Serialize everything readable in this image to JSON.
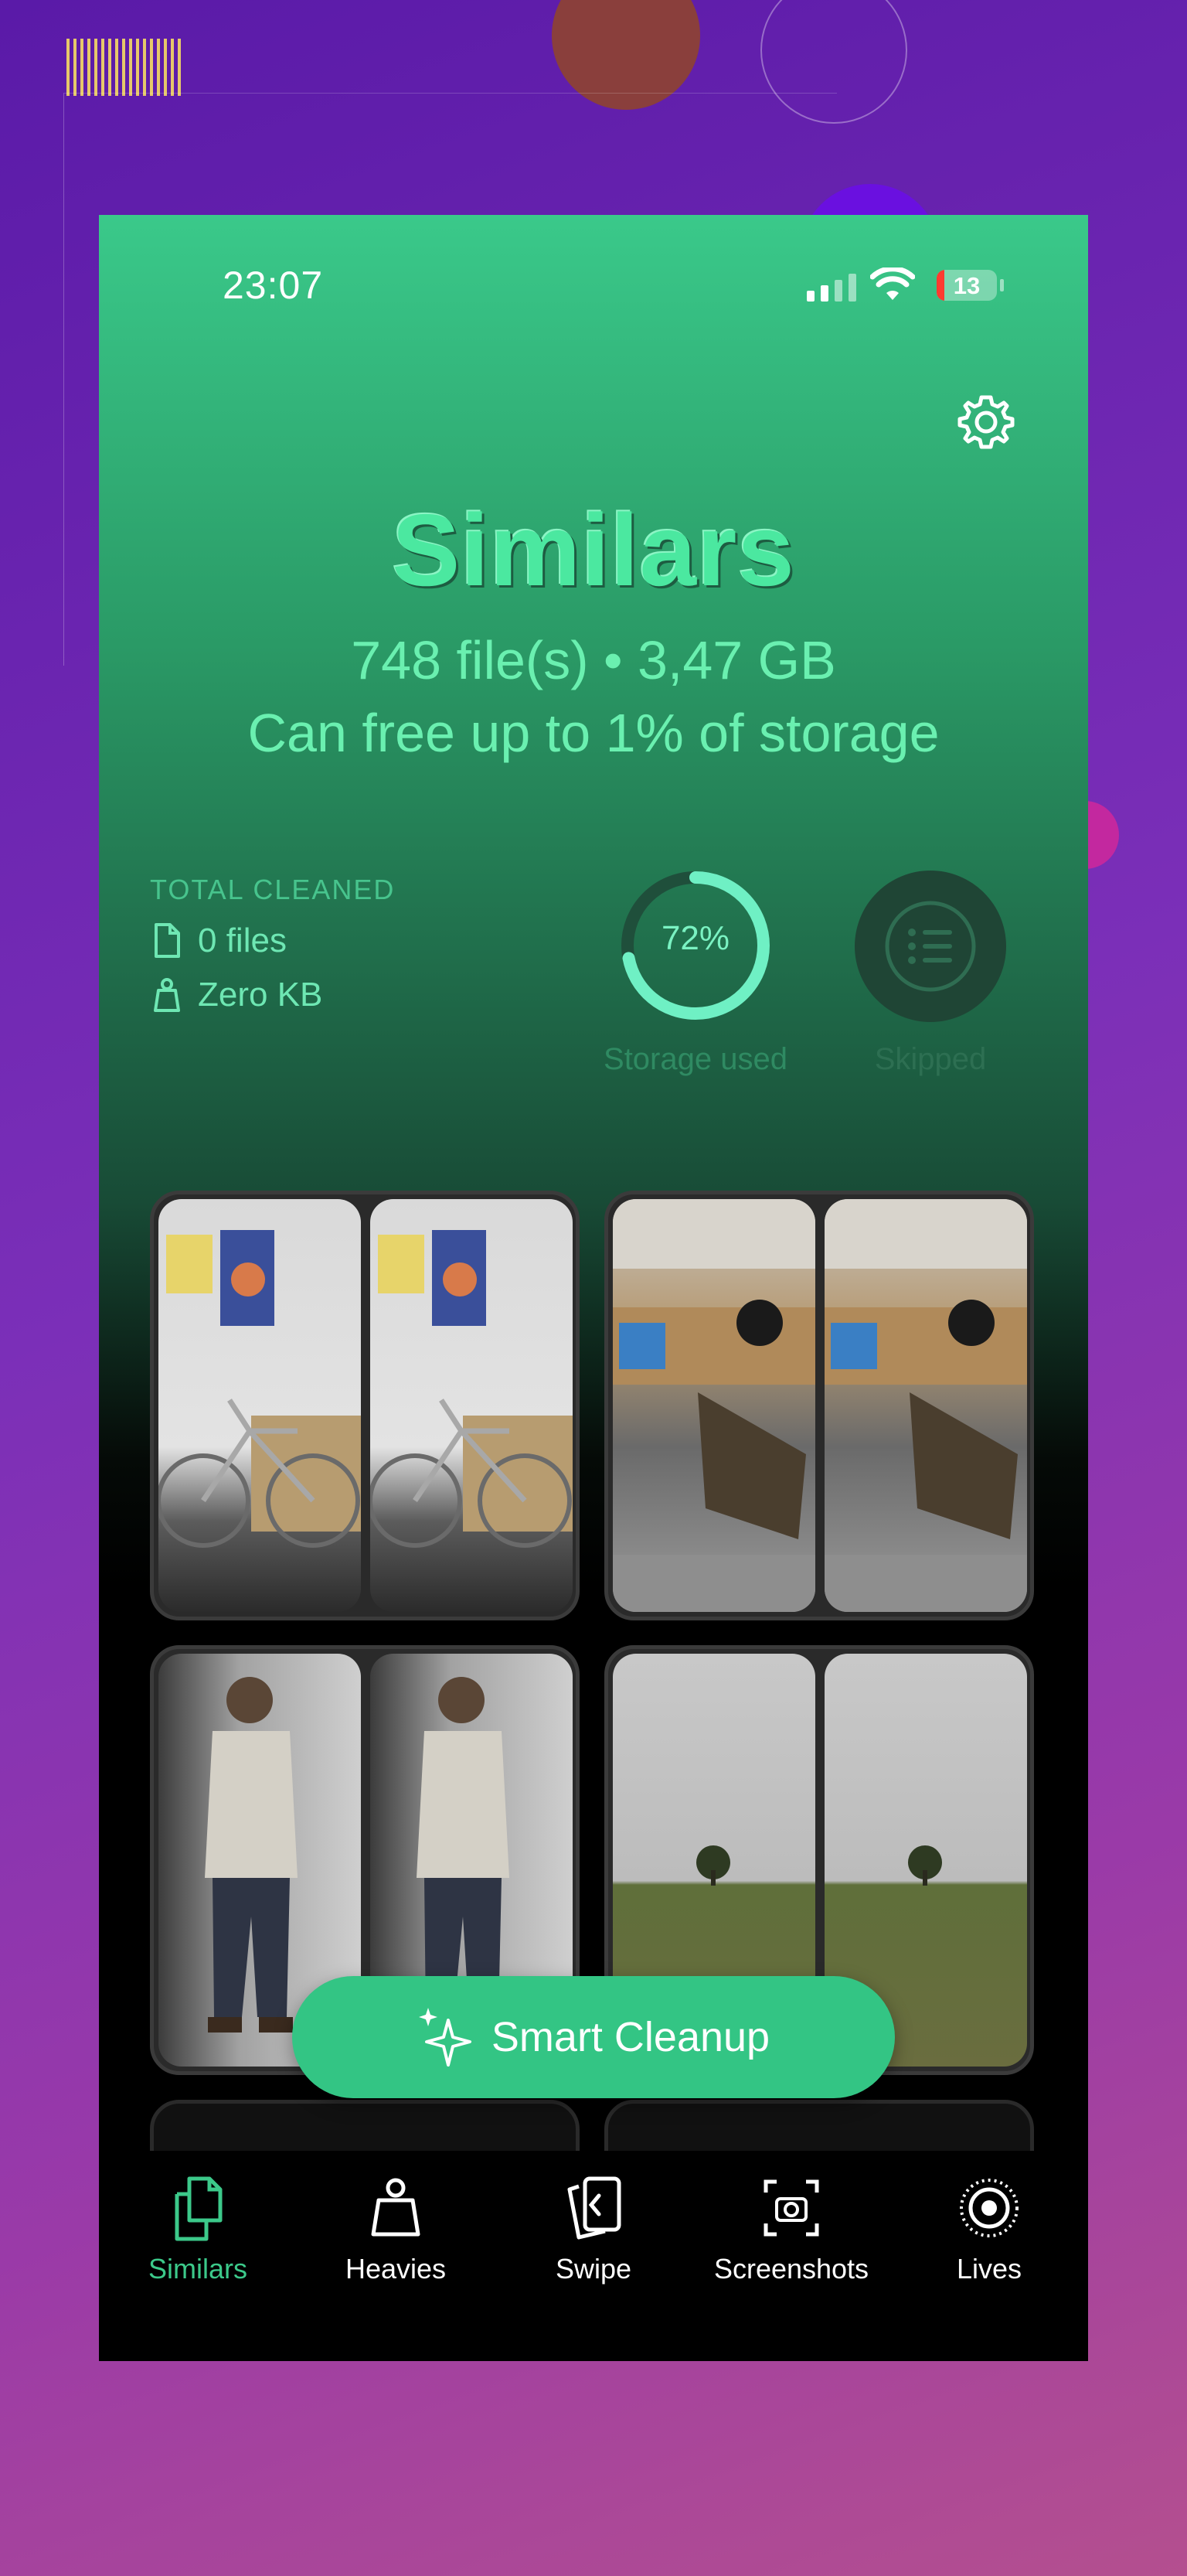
{
  "status_bar": {
    "time": "23:07",
    "battery_level": "13"
  },
  "header": {
    "title": "Similars",
    "summary": "748 file(s) • 3,47 GB",
    "free_up_text": "Can free up to 1% of storage"
  },
  "stats": {
    "total_cleaned_label": "TOTAL CLEANED",
    "files_cleaned": "0 files",
    "size_cleaned": "Zero KB",
    "storage_used_percent": 72,
    "storage_used_text": "72%",
    "storage_used_label": "Storage used",
    "skipped_label": "Skipped"
  },
  "groups": [
    {
      "kind": "bike-photos"
    },
    {
      "kind": "desk-photos"
    },
    {
      "kind": "person-photos"
    },
    {
      "kind": "field-photos"
    }
  ],
  "cta": {
    "label": "Smart Cleanup"
  },
  "tabbar": {
    "tabs": [
      {
        "label": "Similars",
        "icon": "copy-icon",
        "active": true
      },
      {
        "label": "Heavies",
        "icon": "weight-icon",
        "active": false
      },
      {
        "label": "Swipe",
        "icon": "swipe-icon",
        "active": false
      },
      {
        "label": "Screenshots",
        "icon": "screenshot-icon",
        "active": false
      },
      {
        "label": "Lives",
        "icon": "live-photo-icon",
        "active": false
      }
    ]
  },
  "colors": {
    "accent": "#3cc98a",
    "background_top": "#3ac98a",
    "background_bottom": "#000000"
  }
}
